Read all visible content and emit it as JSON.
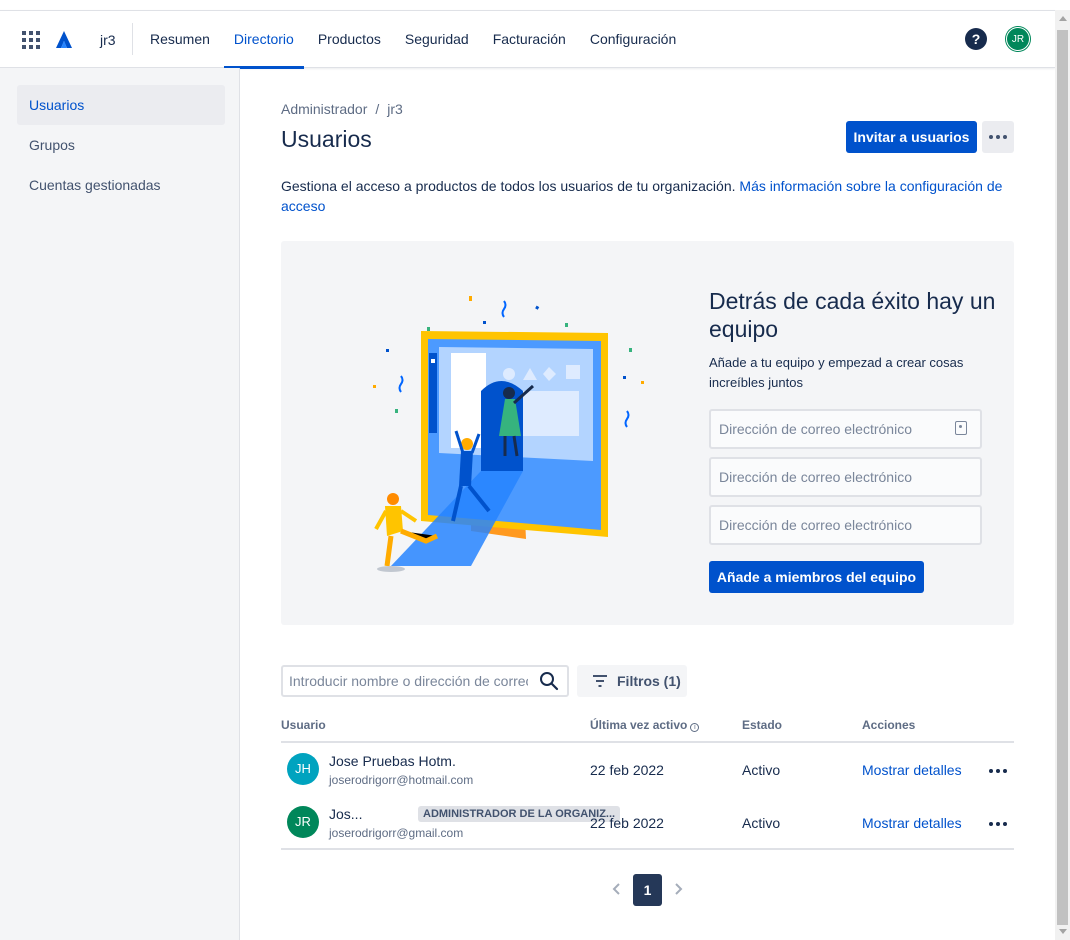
{
  "header": {
    "org": "jr3",
    "nav": [
      {
        "label": "Resumen",
        "active": false
      },
      {
        "label": "Directorio",
        "active": true
      },
      {
        "label": "Productos",
        "active": false
      },
      {
        "label": "Seguridad",
        "active": false
      },
      {
        "label": "Facturación",
        "active": false
      },
      {
        "label": "Configuración",
        "active": false
      }
    ],
    "help_glyph": "?",
    "avatar_initials": "JR"
  },
  "sidebar": {
    "items": [
      {
        "label": "Usuarios",
        "active": true
      },
      {
        "label": "Grupos",
        "active": false
      },
      {
        "label": "Cuentas gestionadas",
        "active": false
      }
    ]
  },
  "breadcrumb": {
    "root": "Administrador",
    "separator": "/",
    "current": "jr3"
  },
  "page": {
    "title": "Usuarios",
    "invite_label": "Invitar a usuarios",
    "description": "Gestiona el acceso a productos de todos los usuarios de tu organización.",
    "learn_more": "Más información sobre la configuración de acceso"
  },
  "promo": {
    "title": "Detrás de cada éxito hay un equipo",
    "subtitle": "Añade a tu equipo y empezad a crear cosas increíbles juntos",
    "email_placeholder": "Dirección de correo electrónico",
    "add_button": "Añade a miembros del equipo"
  },
  "search": {
    "placeholder": "Introducir nombre o dirección de correo",
    "filters_label": "Filtros (1)"
  },
  "table": {
    "headers": {
      "user": "Usuario",
      "last_active": "Última vez activo",
      "last_active_info": "i",
      "status": "Estado",
      "actions": "Acciones"
    },
    "rows": [
      {
        "initials": "JH",
        "avatar_color": "#00A3BF",
        "name": "Jose Pruebas Hotm.",
        "email": "joserodrigorr@hotmail.com",
        "badge": "",
        "last_active": "22 feb 2022",
        "status": "Activo",
        "action": "Mostrar detalles"
      },
      {
        "initials": "JR",
        "avatar_color": "#00875A",
        "name": "Jos...",
        "email": "joserodrigorr@gmail.com",
        "badge": "ADMINISTRADOR DE LA ORGANIZ...",
        "last_active": "22 feb 2022",
        "status": "Activo",
        "action": "Mostrar detalles"
      }
    ]
  },
  "pagination": {
    "current": "1"
  },
  "colors": {
    "primary": "#0052CC",
    "text": "#172B4D",
    "subtle": "#5E6C84",
    "panel": "#F4F5F7"
  }
}
